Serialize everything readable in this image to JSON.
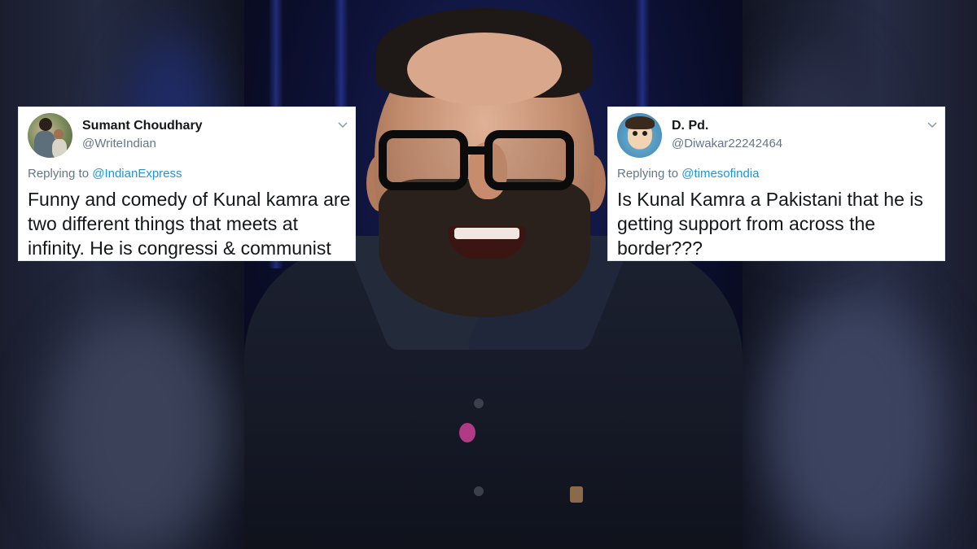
{
  "tweets": [
    {
      "name": "Sumant Choudhary",
      "handle": "@WriteIndian",
      "reply_prefix": "Replying to",
      "reply_to": "@IndianExpress",
      "text": "Funny and comedy of Kunal kamra are two different things that meets at infinity. He is congressi & communist",
      "avatar_icon": "avatar-photo-people-outdoors",
      "menu_icon": "chevron-down-icon"
    },
    {
      "name": "D. Pd.",
      "handle": "@Diwakar22242464",
      "reply_prefix": "Replying to",
      "reply_to": "@timesofindia",
      "text": "Is Kunal Kamra a Pakistani that he is getting support from across the border???",
      "avatar_icon": "avatar-illustration-child",
      "menu_icon": "chevron-down-icon"
    }
  ],
  "colors": {
    "mention": "#1b95e0",
    "secondary_text": "#657786",
    "primary_text": "#14171a",
    "card_background": "#ffffff"
  }
}
